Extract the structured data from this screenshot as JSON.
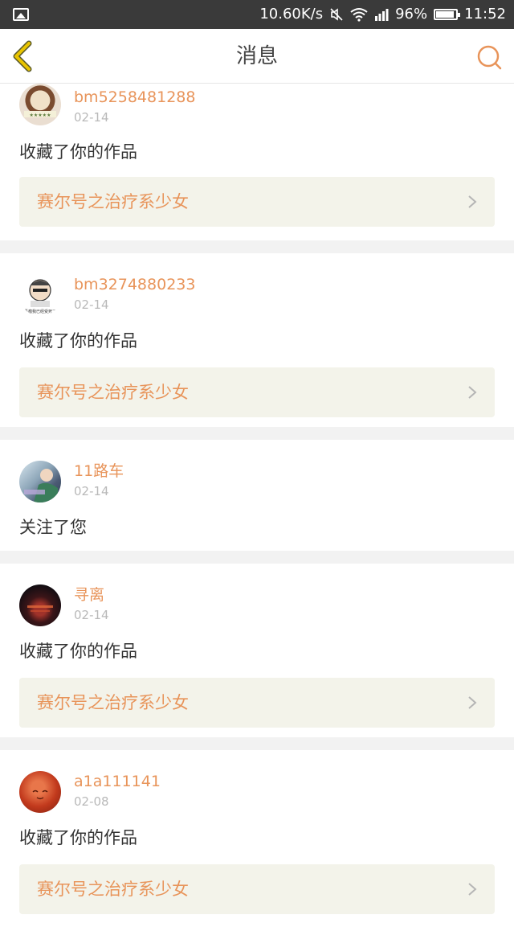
{
  "status_bar": {
    "speed": "10.60K/s",
    "battery": "96%",
    "time": "11:52"
  },
  "header": {
    "title": "消息"
  },
  "colors": {
    "accent": "#e8945a",
    "back_arrow": "#e9b200",
    "card_link_bg": "#f3f3ea"
  },
  "messages": [
    {
      "username": "bm5258481288",
      "date": "02-14",
      "action": "收藏了你的作品",
      "work_title": "赛尔号之治疗系少女"
    },
    {
      "username": "bm3274880233",
      "date": "02-14",
      "action": "收藏了你的作品",
      "work_title": "赛尔号之治疗系少女"
    },
    {
      "username": "11路车",
      "date": "02-14",
      "action": "关注了您",
      "work_title": null
    },
    {
      "username": "寻离",
      "date": "02-14",
      "action": "收藏了你的作品",
      "work_title": "赛尔号之治疗系少女"
    },
    {
      "username": "a1a111141",
      "date": "02-08",
      "action": "收藏了你的作品",
      "work_title": "赛尔号之治疗系少女"
    }
  ]
}
